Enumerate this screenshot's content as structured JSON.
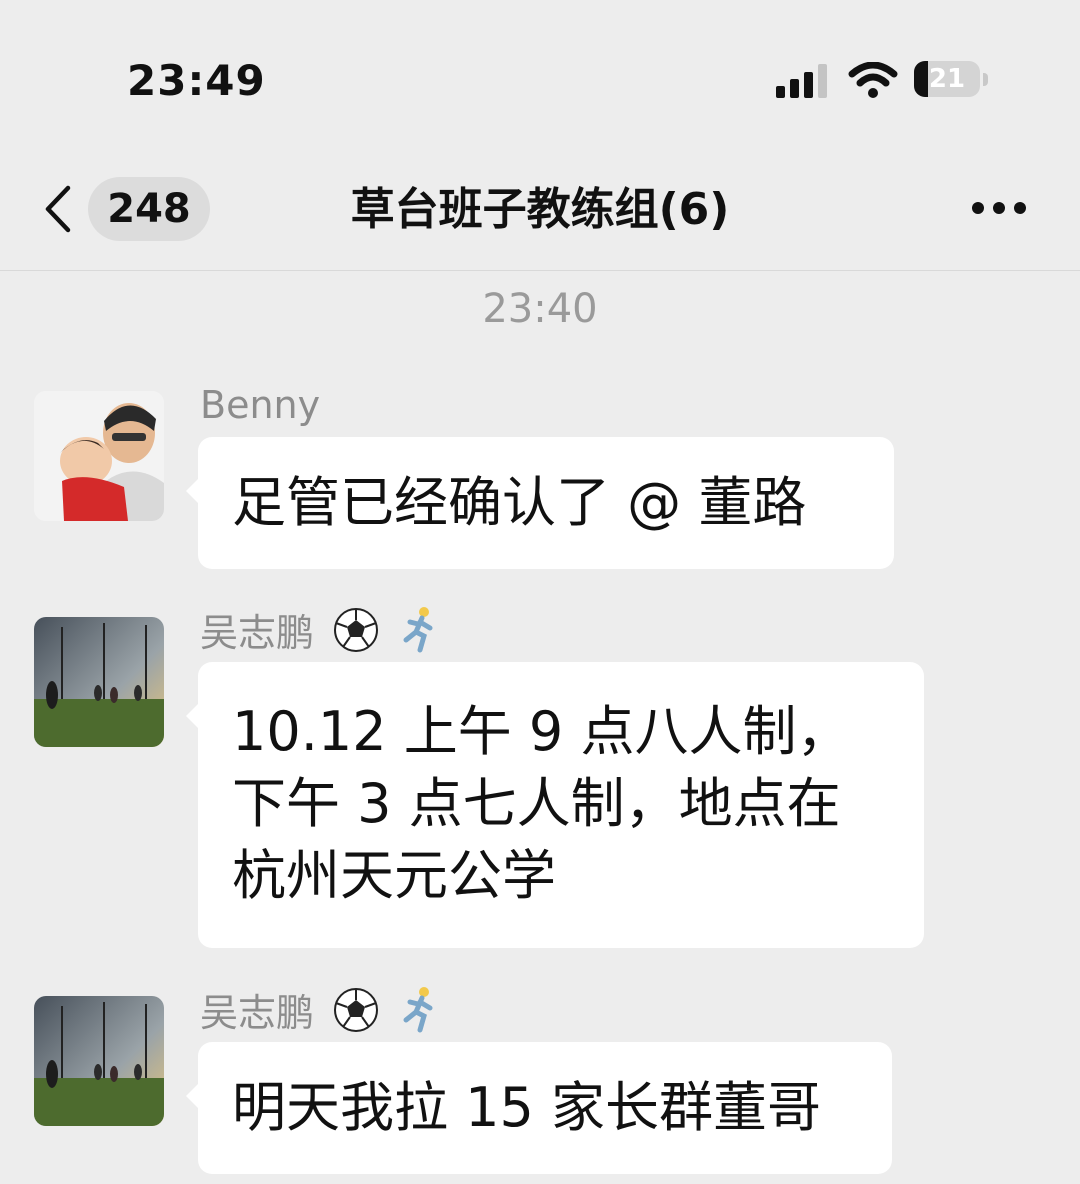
{
  "status_bar": {
    "time": "23:49",
    "battery_level": "21"
  },
  "nav": {
    "back_count": "248",
    "title": "草台班子教练组(6)"
  },
  "timestamp": "23:40",
  "messages": [
    {
      "sender": "Benny",
      "lines": [
        "足管已经确认了 @ 董路"
      ]
    },
    {
      "sender": "吴志鹏",
      "lines": [
        "10.12 上午 9 点八人制，",
        "下午 3 点七人制，地点在",
        "杭州天元公学"
      ]
    },
    {
      "sender": "吴志鹏",
      "lines": [
        "明天我拉 15 家长群董哥"
      ]
    }
  ],
  "icons": {
    "sender_emojis": [
      "soccer-ball-icon",
      "runner-icon"
    ],
    "nav": [
      "back-chevron-icon",
      "more-icon"
    ],
    "status": [
      "cellular-signal-icon",
      "wifi-icon",
      "battery-icon"
    ]
  }
}
